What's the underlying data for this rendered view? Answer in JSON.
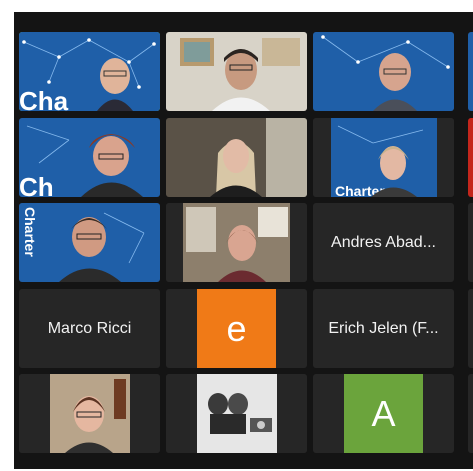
{
  "participants": {
    "tile_1_1": {
      "type": "video",
      "bg": "charter",
      "active": true
    },
    "tile_1_2": {
      "type": "video",
      "bg": "room"
    },
    "tile_1_3": {
      "type": "video",
      "bg": "charter"
    },
    "tile_2_1": {
      "type": "video",
      "bg": "charter"
    },
    "tile_2_2": {
      "type": "video",
      "bg": "room"
    },
    "tile_2_3": {
      "type": "video",
      "bg": "charter"
    },
    "tile_3_1": {
      "type": "video",
      "bg": "charter"
    },
    "tile_3_2": {
      "type": "video",
      "bg": "room"
    },
    "tile_3_3": {
      "type": "name",
      "name": "Andres Abad..."
    },
    "tile_4_1": {
      "type": "name",
      "name": "Marco Ricci"
    },
    "tile_4_2": {
      "type": "avatar",
      "letter": "e",
      "color": "#f07a17"
    },
    "tile_4_3": {
      "type": "name",
      "name": "Erich Jelen (F..."
    },
    "tile_5_1": {
      "type": "video",
      "bg": "room"
    },
    "tile_5_2": {
      "type": "photo",
      "bg": "bw"
    },
    "tile_5_3": {
      "type": "avatar",
      "letter": "A",
      "color": "#6ba43c"
    }
  },
  "colors": {
    "charter_blue": "#1f5fa8",
    "active_border": "#7cd35a",
    "tile_bg": "#262626",
    "frame_bg": "#141414"
  }
}
